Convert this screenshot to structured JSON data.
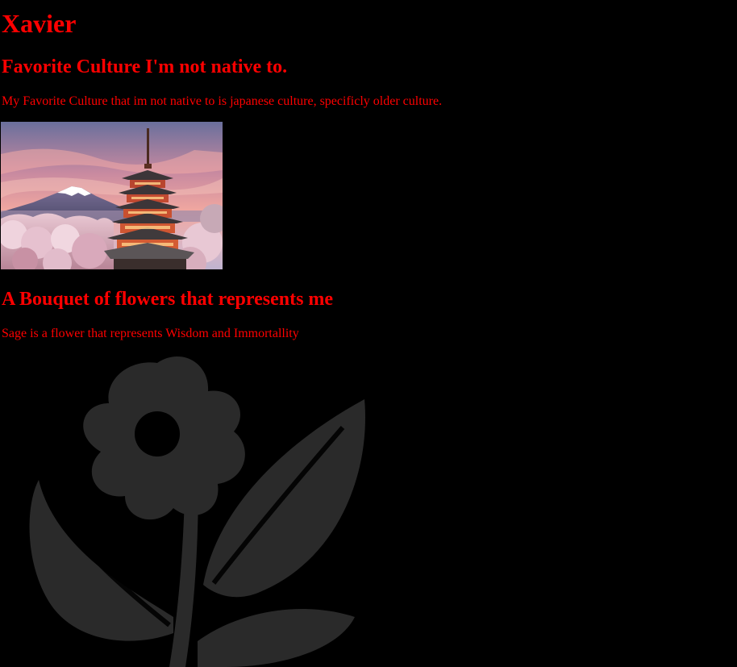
{
  "page": {
    "background_color": "#000000",
    "text_color": "#ff0000"
  },
  "header": {
    "name": "Xavier"
  },
  "culture_section": {
    "heading": "Favorite Culture I'm not native to.",
    "description": "My Favorite Culture that im not native to is japanese culture, specificly older culture.",
    "image_icon": "pagoda-mount-fuji-photo"
  },
  "bouquet_section": {
    "heading": "A Bouquet of flowers that represents me",
    "description": "Sage is a flower that represents Wisdom and Immortallity",
    "background_icon": "flower-silhouette-icon"
  }
}
